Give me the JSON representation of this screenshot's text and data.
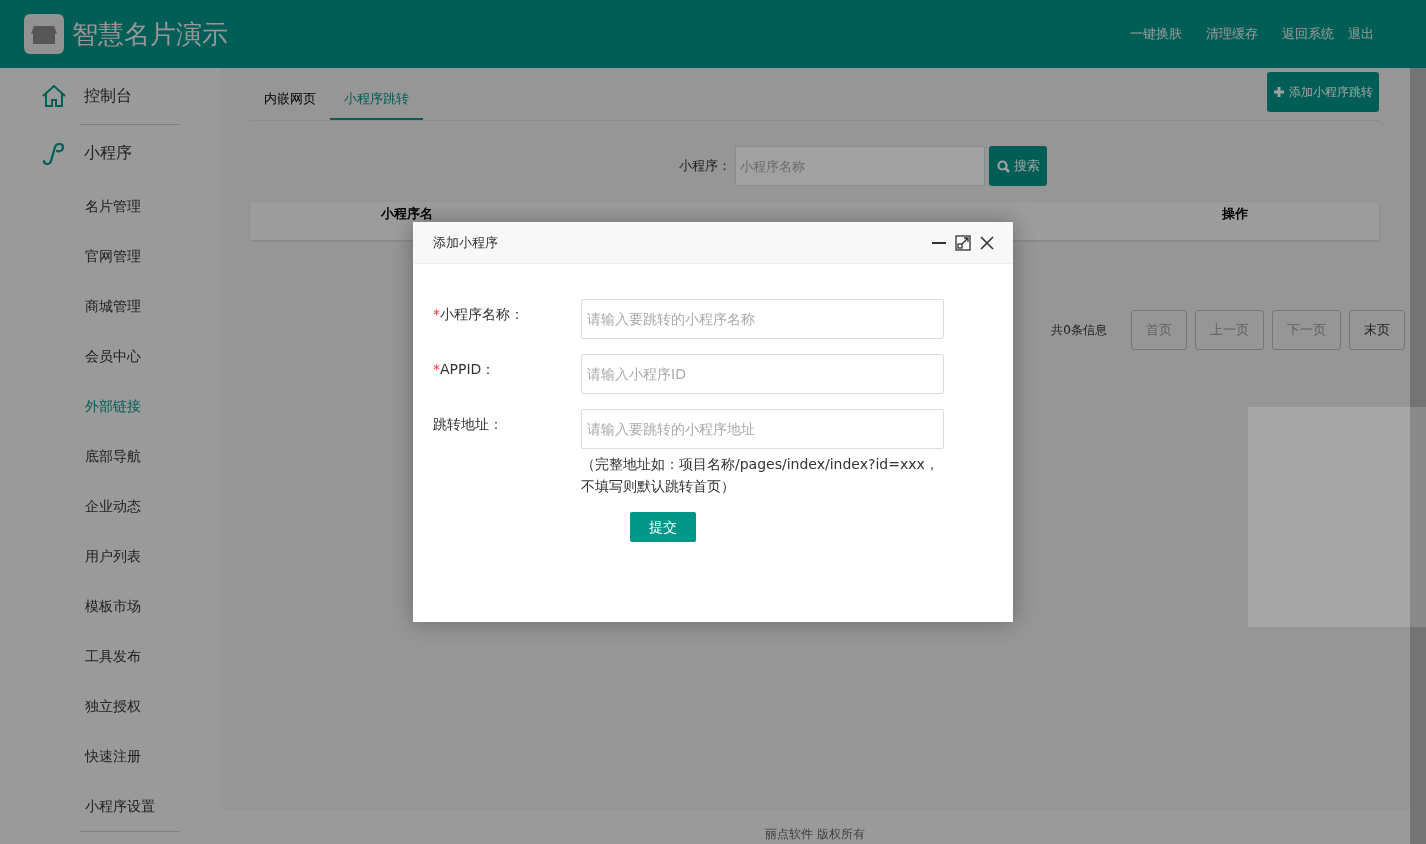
{
  "header": {
    "logo_text": "智慧名片演示",
    "links": [
      "一键换肤",
      "清理缓存",
      "返回系统",
      "退出"
    ]
  },
  "sidebar": {
    "items": [
      {
        "label": "控制台",
        "kind": "home",
        "selected": false
      },
      {
        "label": "小程序",
        "kind": "miniapp",
        "selected": false,
        "children": [
          {
            "label": "名片管理",
            "selected": false
          },
          {
            "label": "官网管理",
            "selected": false
          },
          {
            "label": "商城管理",
            "selected": false
          },
          {
            "label": "会员中心",
            "selected": false
          },
          {
            "label": "外部链接",
            "selected": true
          },
          {
            "label": "底部导航",
            "selected": false
          },
          {
            "label": "企业动态",
            "selected": false
          },
          {
            "label": "用户列表",
            "selected": false
          },
          {
            "label": "模板市场",
            "selected": false
          },
          {
            "label": "工具发布",
            "selected": false
          },
          {
            "label": "独立授权",
            "selected": false
          },
          {
            "label": "快速注册",
            "selected": false
          },
          {
            "label": "小程序设置",
            "selected": false
          }
        ]
      }
    ]
  },
  "tabs": [
    {
      "label": "内嵌网页",
      "selected": false
    },
    {
      "label": "小程序跳转",
      "selected": true
    }
  ],
  "add_button": "添加小程序跳转",
  "search": {
    "label": "小程序：",
    "placeholder": "小程序名称",
    "button": "搜索"
  },
  "table": {
    "columns": [
      "小程序名",
      "操作"
    ]
  },
  "pagination": {
    "summary": "共0条信息",
    "buttons": [
      {
        "label": "首页",
        "disabled": true
      },
      {
        "label": "上一页",
        "disabled": true
      },
      {
        "label": "下一页",
        "disabled": true
      },
      {
        "label": "末页",
        "disabled": false
      }
    ]
  },
  "modal": {
    "title": "添加小程序",
    "fields": [
      {
        "marker": "*",
        "label": "小程序名称：",
        "placeholder": "请输入要跳转的小程序名称"
      },
      {
        "marker": "*",
        "label": "APPID：",
        "placeholder": "请输入小程序ID"
      },
      {
        "label": "跳转地址：",
        "placeholder": "请输入要跳转的小程序地址"
      }
    ],
    "hint": "（完整地址如：项目名称/pages/index/index?id=xxx，不填写则默认跳转首页）",
    "submit": "提交"
  },
  "footer": "丽点软件 版权所有"
}
